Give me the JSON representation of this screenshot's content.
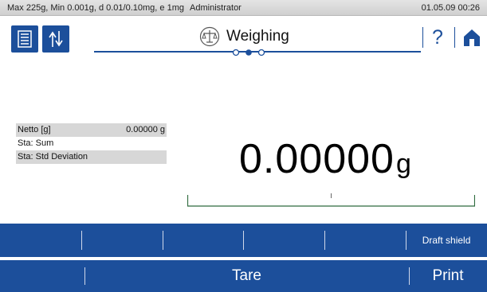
{
  "status_bar": {
    "specs": "Max 225g, Min 0.001g, d 0.01/0.10mg, e 1mg",
    "user": "Administrator",
    "datetime": "01.05.09 00:26"
  },
  "header": {
    "title": "Weighing",
    "title_icon": "balance-scale-icon",
    "left_buttons": [
      "list-menu-icon",
      "up-down-arrows-icon"
    ],
    "help_label": "?",
    "home_icon": "home-icon",
    "page_dots": {
      "count": 3,
      "active": 2
    }
  },
  "stats": [
    {
      "label": "Netto [g]",
      "value": "0.00000 g"
    },
    {
      "label": "Sta: Sum",
      "value": ""
    },
    {
      "label": "Sta: Std Deviation",
      "value": ""
    }
  ],
  "display": {
    "value": "0.00000",
    "unit": "g",
    "capacity_used": 0
  },
  "softkeys": [
    "",
    "",
    "",
    "",
    "",
    "Draft shield"
  ],
  "function_keys": {
    "left": "",
    "tare": "Tare",
    "print": "Print"
  },
  "colors": {
    "accent": "#1c4f9b",
    "row_shade": "#d7d7d7",
    "status_bg": "#d8d8d8"
  }
}
